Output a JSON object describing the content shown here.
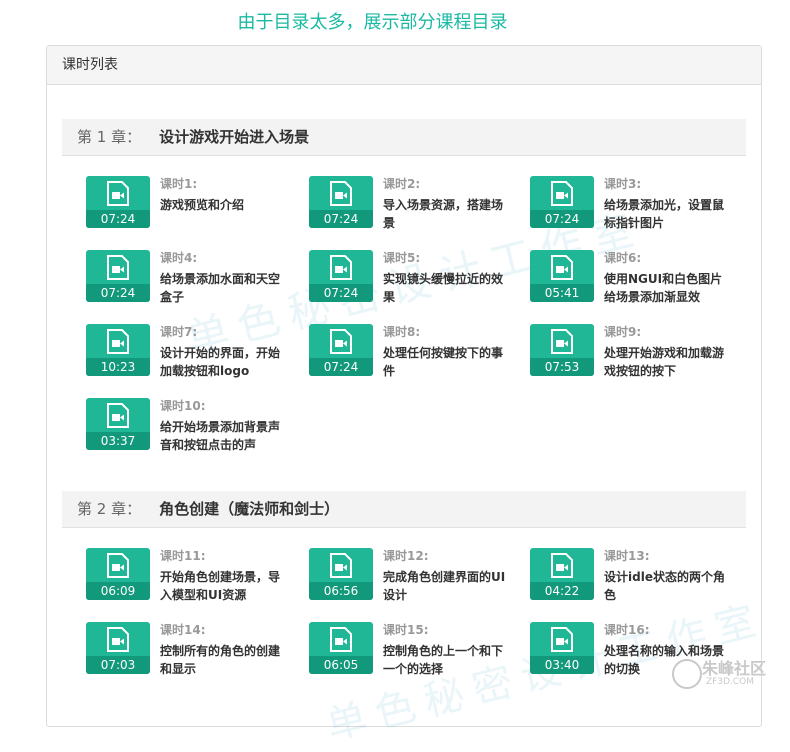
{
  "notice": "由于目录太多，展示部分课程目录",
  "panel": {
    "title": "课时列表"
  },
  "chapters": [
    {
      "label": "第 1 章：",
      "title": "设计游戏开始进入场景",
      "lessons": [
        {
          "tag": "课时1:",
          "title": "游戏预览和介绍",
          "duration": "07:24"
        },
        {
          "tag": "课时2:",
          "title": "导入场景资源，搭建场景",
          "duration": "07:24"
        },
        {
          "tag": "课时3:",
          "title": "给场景添加光，设置鼠标指针图片",
          "duration": "07:24"
        },
        {
          "tag": "课时4:",
          "title": "给场景添加水面和天空盒子",
          "duration": "07:24"
        },
        {
          "tag": "课时5:",
          "title": "实现镜头缓慢拉近的效果",
          "duration": "07:24"
        },
        {
          "tag": "课时6:",
          "title": "使用NGUI和白色图片给场景添加渐显效",
          "duration": "05:41"
        },
        {
          "tag": "课时7:",
          "title": "设计开始的界面，开始加载按钮和logo",
          "duration": "10:23"
        },
        {
          "tag": "课时8:",
          "title": "处理任何按键按下的事件",
          "duration": "07:24"
        },
        {
          "tag": "课时9:",
          "title": "处理开始游戏和加载游戏按钮的按下",
          "duration": "07:53"
        },
        {
          "tag": "课时10:",
          "title": "给开始场景添加背景声音和按钮点击的声",
          "duration": "03:37"
        }
      ]
    },
    {
      "label": "第 2 章：",
      "title": "角色创建（魔法师和剑士）",
      "lessons": [
        {
          "tag": "课时11:",
          "title": "开始角色创建场景，导入模型和UI资源",
          "duration": "06:09"
        },
        {
          "tag": "课时12:",
          "title": "完成角色创建界面的UI设计",
          "duration": "06:56"
        },
        {
          "tag": "课时13:",
          "title": "设计idle状态的两个角色",
          "duration": "04:22"
        },
        {
          "tag": "课时14:",
          "title": "控制所有的角色的创建和显示",
          "duration": "07:03"
        },
        {
          "tag": "课时15:",
          "title": "控制角色的上一个和下一个的选择",
          "duration": "06:05"
        },
        {
          "tag": "课时16:",
          "title": "处理名称的输入和场景的切换",
          "duration": "03:40"
        }
      ]
    }
  ],
  "watermark": "单色秘密设计工作室",
  "logo": {
    "name": "朱峰社区",
    "domain": "ZF3D.COM"
  },
  "colors": {
    "accent": "#1fb795",
    "accent_dark": "#12987a",
    "notice": "#1bb9a4"
  }
}
